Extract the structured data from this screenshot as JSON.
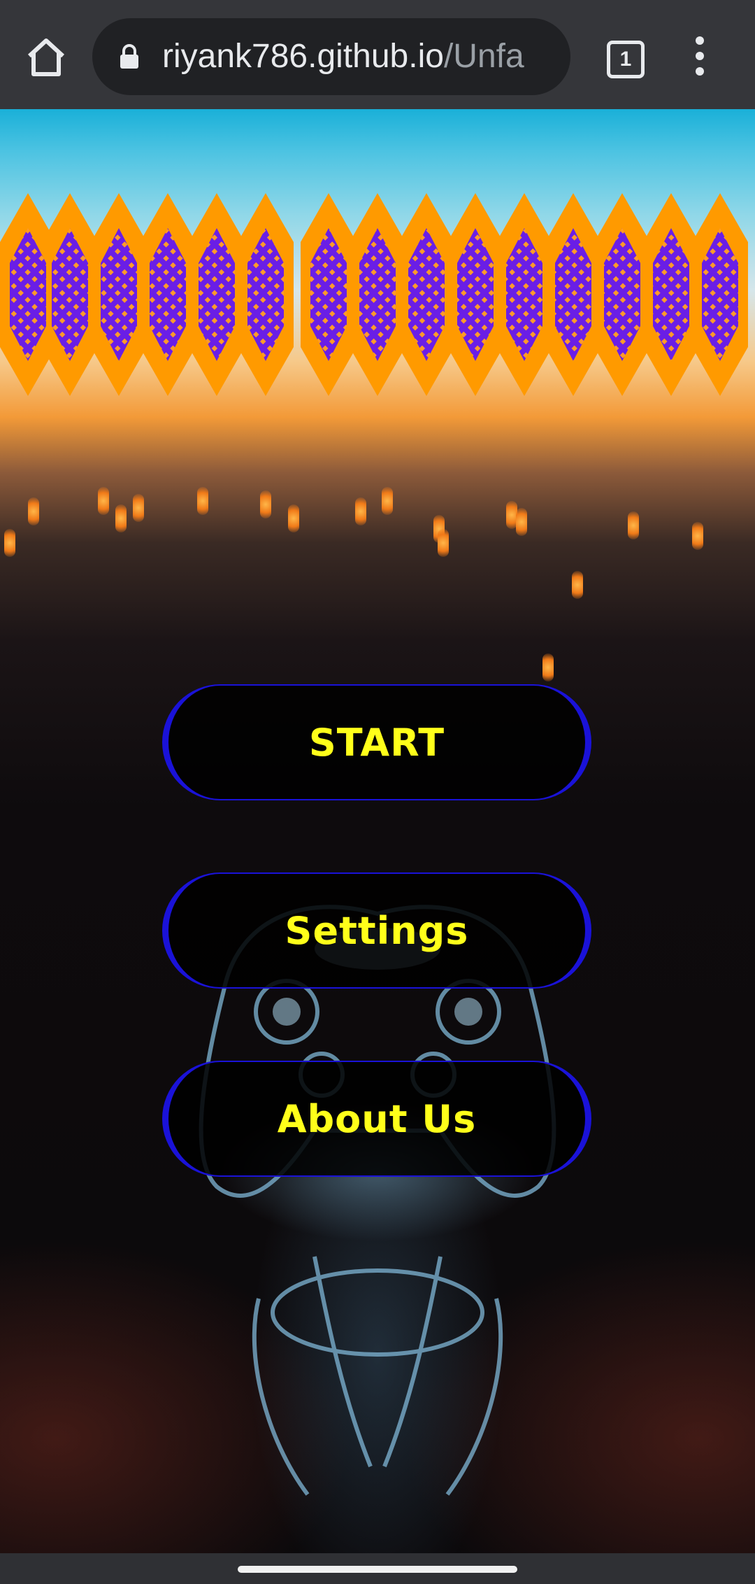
{
  "browser": {
    "url_host": "riyank786.github.io",
    "url_path": "/Unfa",
    "tab_count": "1",
    "icons": {
      "home": "home-icon",
      "lock": "lock-icon",
      "tabs": "tab-switcher-icon",
      "menu": "more-vert-icon"
    }
  },
  "game": {
    "menu": {
      "start_label": "START",
      "settings_label": "Settings",
      "about_label": "About Us"
    },
    "colors": {
      "button_text": "#ffff1a",
      "button_border": "#1a12d8",
      "title_fill": "#6a1ee6",
      "title_outline": "#ff9a00"
    }
  }
}
